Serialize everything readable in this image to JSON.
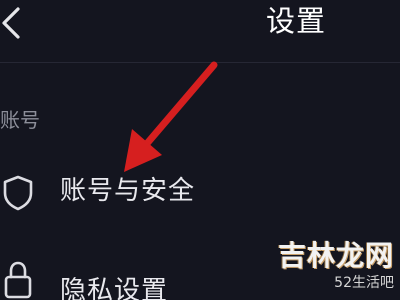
{
  "header": {
    "title": "设置",
    "back_icon": "chevron-left-icon"
  },
  "sections": [
    {
      "label": "账号",
      "items": [
        {
          "label": "账号与安全",
          "icon": "shield-icon"
        },
        {
          "label": "隐私设置",
          "icon": "lock-icon"
        }
      ]
    }
  ],
  "annotation": {
    "type": "arrow",
    "color": "#d61f1f",
    "target": "账号与安全"
  },
  "watermark": {
    "brand": "吉林龙网",
    "sub": "52生活吧"
  },
  "colors": {
    "background": "#14151f",
    "text_primary": "#e9e9ee",
    "text_secondary": "#8d8f9a"
  }
}
